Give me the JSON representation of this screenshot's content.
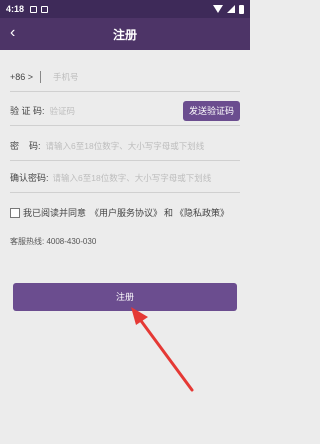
{
  "statusbar": {
    "time": "4:18"
  },
  "header": {
    "title": "注册",
    "back_icon": "‹"
  },
  "form": {
    "phone": {
      "prefix": "+86 >",
      "placeholder": "手机号"
    },
    "code": {
      "label": "验 证 码:",
      "placeholder": "验证码",
      "button": "发送验证码"
    },
    "password": {
      "label": "密    码:",
      "placeholder": "请输入6至18位数字、大小写字母或下划线"
    },
    "confirm": {
      "label": "确认密码:",
      "placeholder": "请输入6至18位数字、大小写字母或下划线"
    }
  },
  "agreement": {
    "prefix": "我已阅读并同意",
    "terms": "《用户服务协议》",
    "and": "和",
    "privacy": "《隐私政策》"
  },
  "hotline": "客服热线: 4008-430-030",
  "register_button": "注册",
  "colors": {
    "header": "#4d3467",
    "statusbar": "#3e2a59",
    "accent": "#6b4d8f",
    "arrow": "#e53935"
  }
}
